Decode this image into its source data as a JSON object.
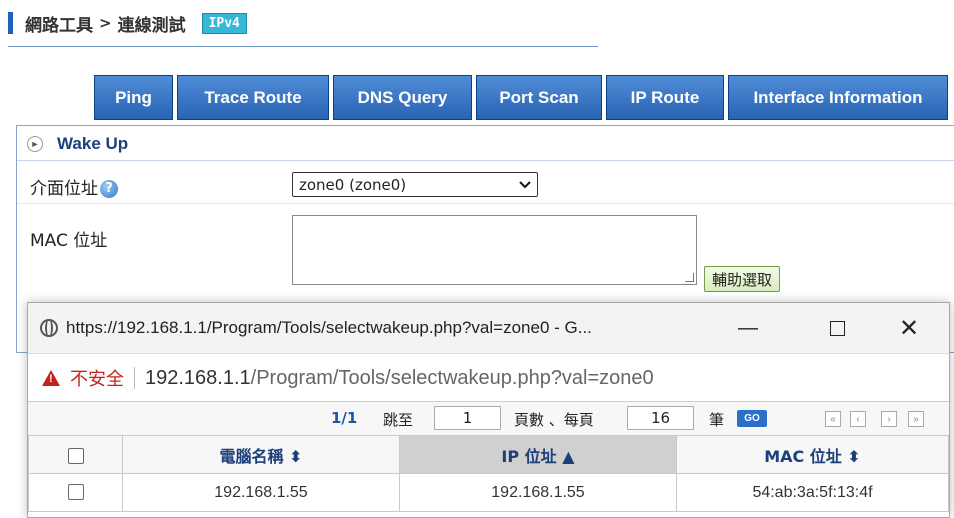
{
  "header": {
    "crumb1": "網路工具",
    "separator": ">",
    "crumb2": "連線測試",
    "badge": "IPv4"
  },
  "tabs": [
    "Ping",
    "Trace Route",
    "DNS Query",
    "Port Scan",
    "IP Route",
    "Interface Information"
  ],
  "section": {
    "title": "Wake Up",
    "interface_label": "介面位址",
    "interface_value": "zone0 (zone0)",
    "mac_label": "MAC 位址",
    "mac_value": "",
    "assist_button": "輔助選取"
  },
  "popup": {
    "window_title": "https://192.168.1.1/Program/Tools/selectwakeup.php?val=zone0 - G...",
    "insecure_label": "不安全",
    "url_host": "192.168.1.1",
    "url_path": "/Program/Tools/selectwakeup.php?val=zone0",
    "pager": {
      "page_info": "1/1",
      "jump_label": "跳至",
      "jump_value": "1",
      "page_label": "頁數 、每頁",
      "per_page_value": "16",
      "unit_label": "筆",
      "go_label": "GO"
    },
    "table": {
      "headers": [
        "電腦名稱 ⬍",
        "IP 位址 ▲",
        "MAC 位址 ⬍"
      ],
      "rows": [
        {
          "name": "192.168.1.55",
          "ip": "192.168.1.55",
          "mac": "54:ab:3a:5f:13:4f"
        }
      ]
    }
  },
  "colors": {
    "accent": "#1d64b6",
    "tab_bg": "#2a64b4",
    "badge_bg": "#37b6d6",
    "warning": "#c5221f"
  }
}
